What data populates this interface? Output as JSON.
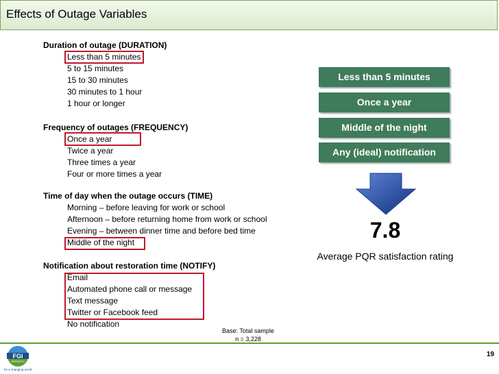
{
  "slide": {
    "title": "Effects of Outage Variables",
    "page_number": "19",
    "logo_text": "FGI",
    "logo_sub": "RESEARCH",
    "logo_tagline": "for a changing world"
  },
  "sections": [
    {
      "heading": "Duration of outage (DURATION)",
      "options": [
        "Less than 5 minutes",
        "5 to 15 minutes",
        "15 to 30 minutes",
        "30 minutes to 1 hour",
        "1 hour or longer"
      ]
    },
    {
      "heading": "Frequency of outages (FREQUENCY)",
      "options": [
        "Once a year",
        "Twice a year",
        "Three times a year",
        "Four or more times a year"
      ]
    },
    {
      "heading": "Time of day when the outage occurs (TIME)",
      "options": [
        "Morning – before leaving for work or school",
        "Afternoon – before returning home from work or school",
        "Evening – between dinner time and before bed time",
        "Middle of the night"
      ]
    },
    {
      "heading": "Notification about restoration time (NOTIFY)",
      "options": [
        "Email",
        "Automated phone call or message",
        "Text message",
        "Twitter or Facebook feed",
        "No notification"
      ]
    }
  ],
  "scenario": {
    "items": [
      "Less than 5 minutes",
      "Once a year",
      "Middle of the night",
      "Any (ideal) notification"
    ],
    "rating": "7.8",
    "rating_label": "Average PQR satisfaction rating"
  },
  "base": {
    "line1": "Base: Total sample",
    "line2": "n = 3,228"
  },
  "colors": {
    "accent_green": "#3f7c5b",
    "highlight_red": "#c0182a",
    "arrow_blue": "#1d3f96"
  }
}
